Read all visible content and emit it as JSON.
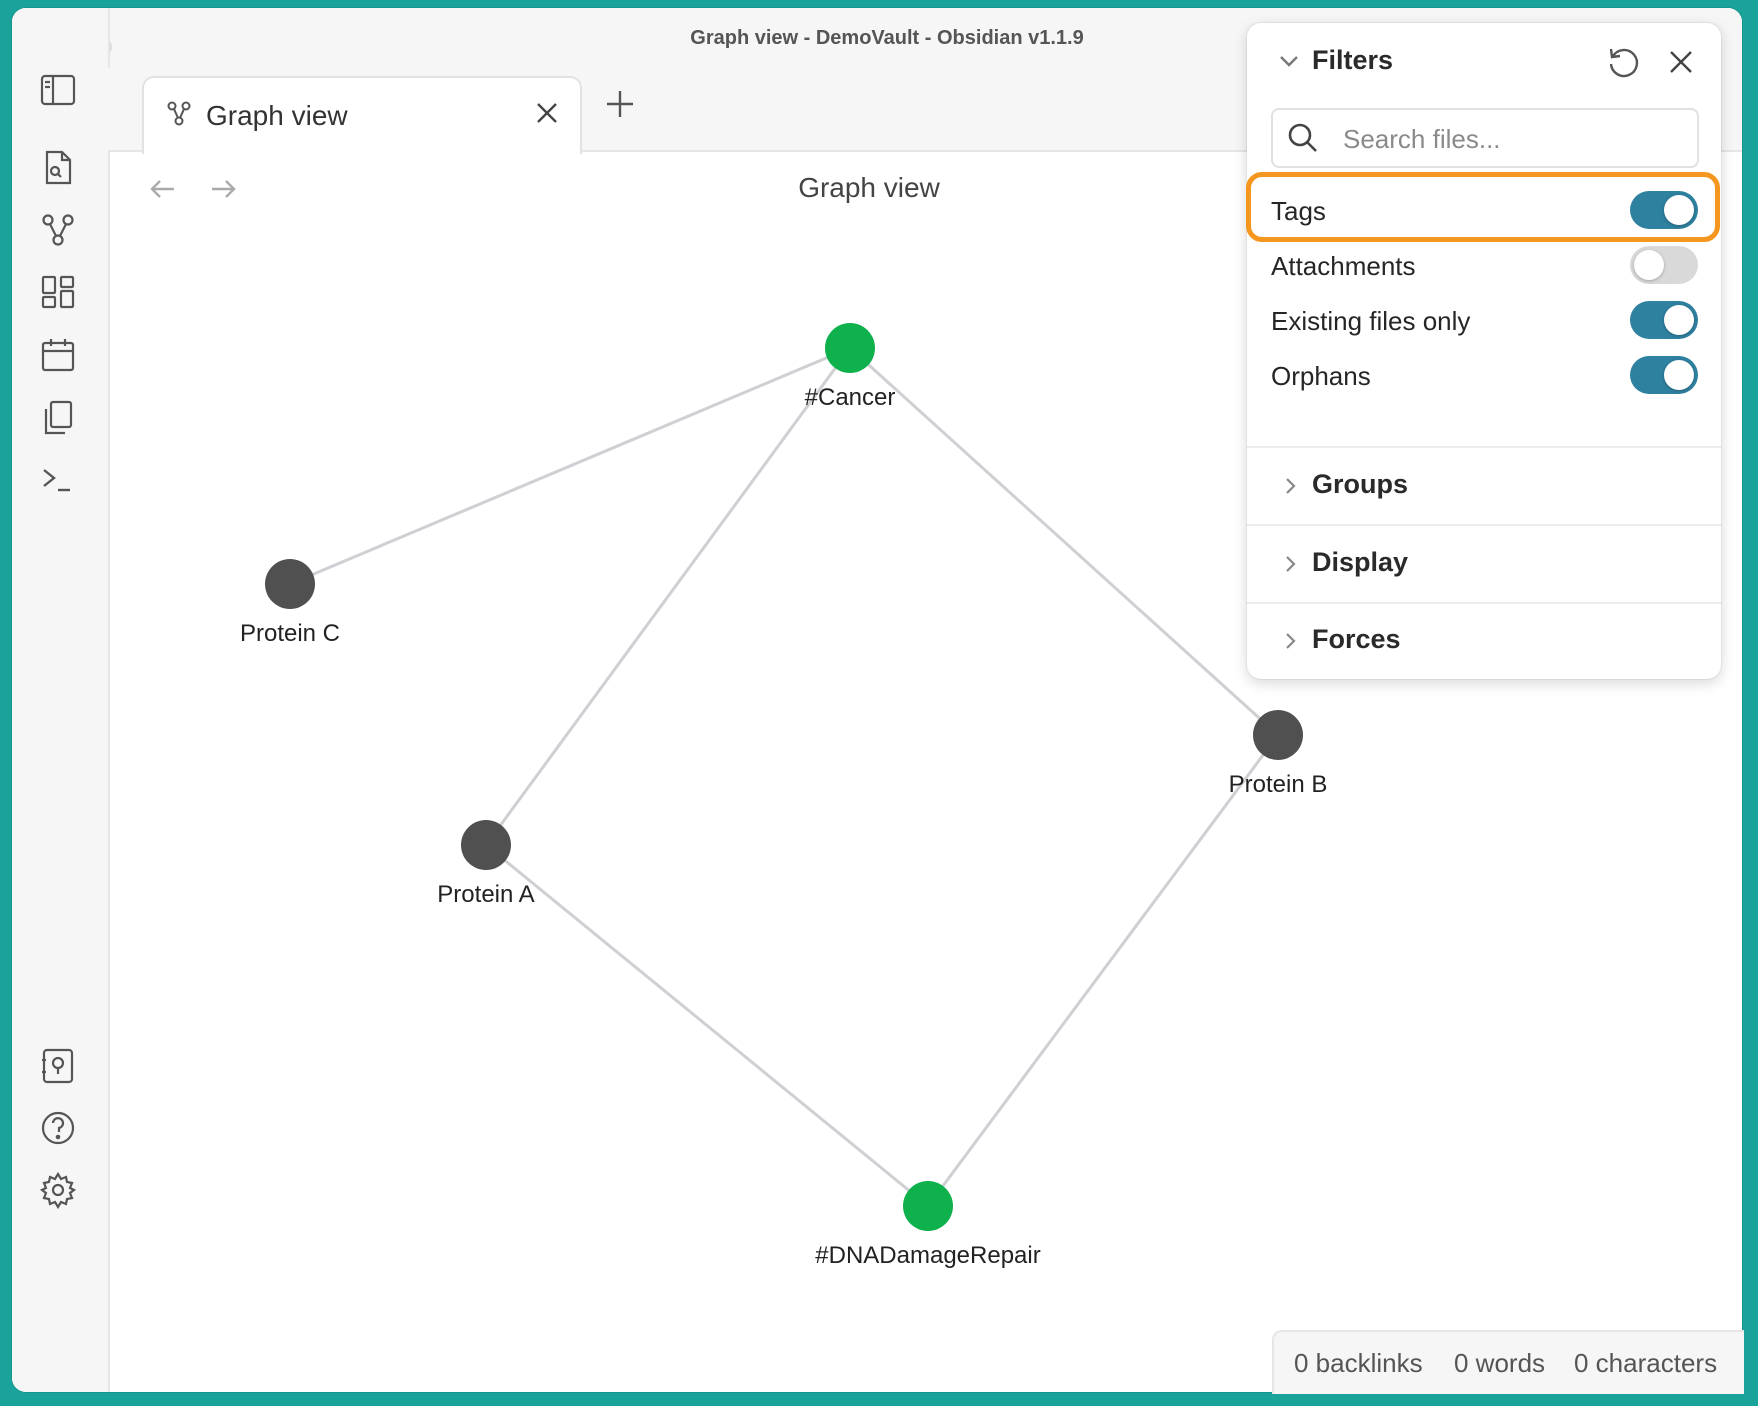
{
  "window": {
    "title": "Graph view - DemoVault - Obsidian v1.1.9"
  },
  "tab": {
    "label": "Graph view"
  },
  "view": {
    "title": "Graph view"
  },
  "filters": {
    "title": "Filters",
    "search_placeholder": "Search files...",
    "toggles": [
      {
        "label": "Tags",
        "on": true
      },
      {
        "label": "Attachments",
        "on": false
      },
      {
        "label": "Existing files only",
        "on": true
      },
      {
        "label": "Orphans",
        "on": true
      }
    ],
    "sections": [
      {
        "label": "Groups"
      },
      {
        "label": "Display"
      },
      {
        "label": "Forces"
      }
    ]
  },
  "graph": {
    "nodes": [
      {
        "label": "#Cancer",
        "type": "tag"
      },
      {
        "label": "Protein C",
        "type": "file"
      },
      {
        "label": "Protein B",
        "type": "file"
      },
      {
        "label": "Protein A",
        "type": "file"
      },
      {
        "label": "#DNADamageRepair",
        "type": "tag"
      }
    ],
    "colors": {
      "tag": "#0fb14c",
      "file": "#505050",
      "edge": "#cfcfd4"
    }
  },
  "status": {
    "backlinks": "0 backlinks",
    "words": "0 words",
    "characters": "0 characters"
  },
  "colors": {
    "accent": "#2f81a0",
    "highlight": "#f5961e",
    "background": "#1aa39a"
  }
}
